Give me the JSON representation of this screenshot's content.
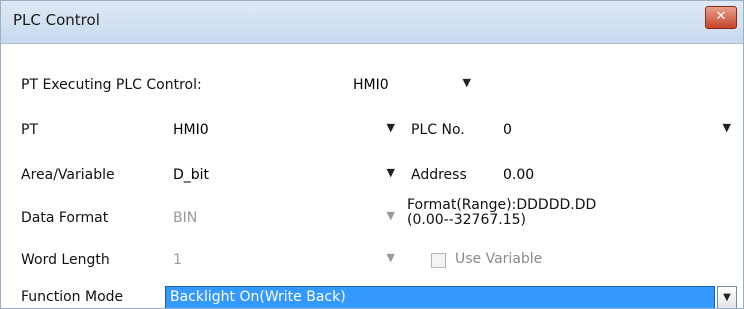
{
  "window": {
    "title": "PLC Control",
    "close_glyph": "✕"
  },
  "form": {
    "pt_exec_label": "PT Executing PLC Control:",
    "pt_exec_value": "HMI0",
    "pt_label": "PT",
    "pt_value": "HMI0",
    "plc_no_label": "PLC No.",
    "plc_no_value": "0",
    "area_label": "Area/Variable",
    "area_value": "D_bit",
    "address_label": "Address",
    "address_value": "0.00",
    "data_format_label": "Data Format",
    "data_format_value": "BIN",
    "format_note_line1": "Format(Range):DDDDD.DD",
    "format_note_line2": "(0.00--32767.15)",
    "word_length_label": "Word Length",
    "word_length_value": "1",
    "use_variable_label": "Use Variable",
    "use_variable_checked": false,
    "function_mode_label": "Function Mode",
    "function_mode_value": "Backlight On(Write Back)"
  },
  "icons": {
    "dropdown": "chevron-down-icon",
    "close": "close-icon"
  },
  "colors": {
    "selection": "#3399ff",
    "title_bar": "#c8d9ee",
    "close_button": "#c7442b"
  }
}
